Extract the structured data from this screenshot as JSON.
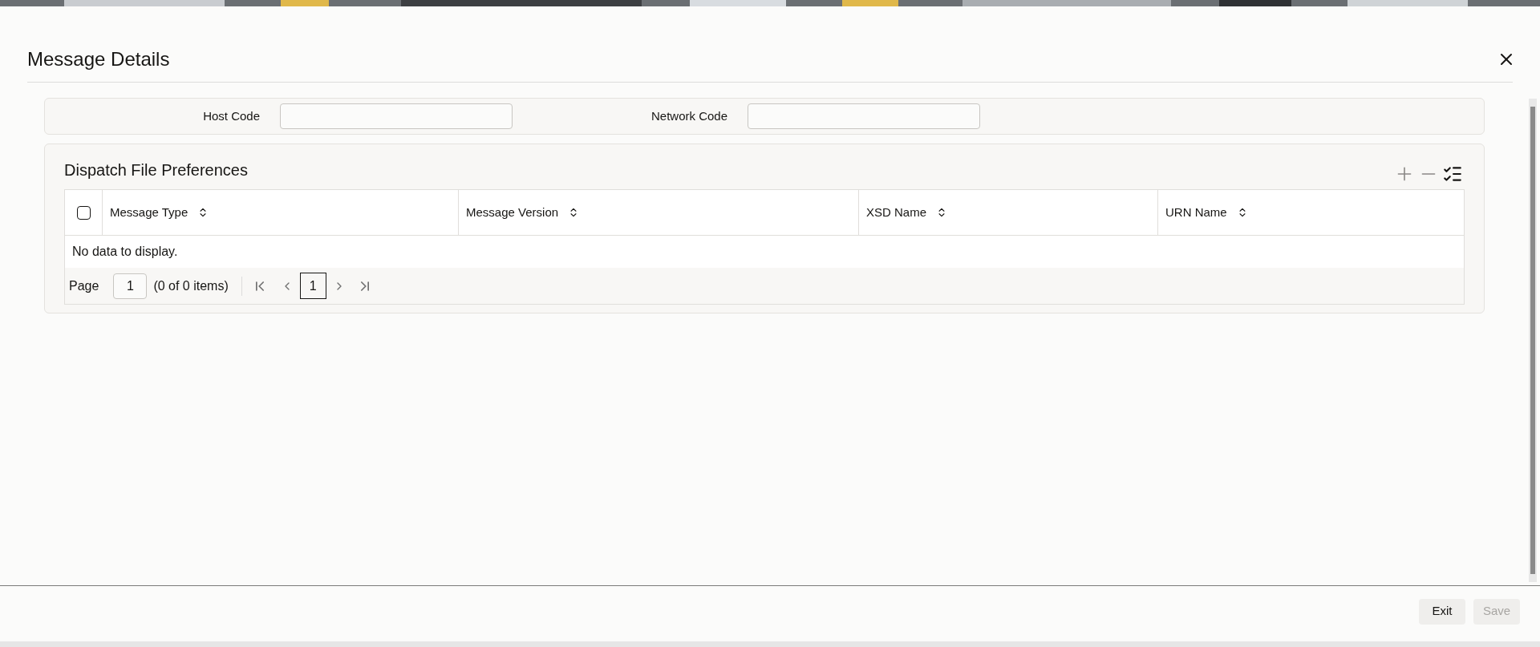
{
  "dialog": {
    "title": "Message Details"
  },
  "fields": [
    {
      "label": "Host Code"
    },
    {
      "label": "Network Code"
    }
  ],
  "section": {
    "title": "Dispatch File Preferences",
    "table": {
      "select_all": {
        "checked": false
      },
      "columns": [
        {
          "label": "Message Type"
        },
        {
          "label": "Message Version"
        },
        {
          "label": "XSD Name"
        },
        {
          "label": "URN Name"
        }
      ],
      "empty_message": "No data to display.",
      "pager": {
        "page_label": "Page",
        "page_value": "1",
        "summary": "(0 of 0 items)",
        "pages": [
          {
            "label": "1",
            "selected": true
          }
        ]
      }
    }
  },
  "buttons": [
    {
      "label": "Exit",
      "disabled": false
    },
    {
      "label": "Save",
      "disabled": true
    }
  ]
}
